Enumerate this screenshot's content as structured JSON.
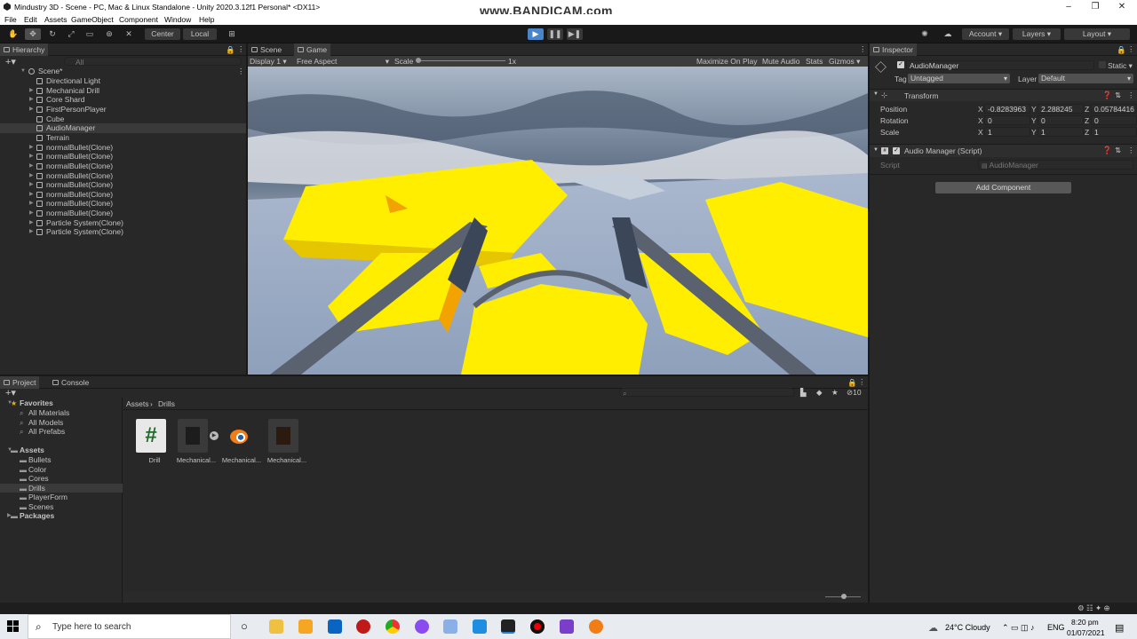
{
  "window": {
    "title": "Mindustry 3D - Scene - PC, Mac & Linux Standalone - Unity 2020.3.12f1 Personal* <DX11>",
    "watermark": "www.BANDICAM.com"
  },
  "menu": [
    "File",
    "Edit",
    "Assets",
    "GameObject",
    "Component",
    "Window",
    "Help"
  ],
  "toolbar": {
    "pivot": "Center",
    "space": "Local",
    "account": "Account",
    "layers": "Layers",
    "layout": "Layout"
  },
  "hierarchy": {
    "tab": "Hierarchy",
    "search_placeholder": "All",
    "root": "Scene*",
    "items": [
      "Directional Light",
      "Mechanical Drill",
      "Core Shard",
      "FirstPersonPlayer",
      "Cube",
      "AudioManager",
      "Terrain",
      "normalBullet(Clone)",
      "normalBullet(Clone)",
      "normalBullet(Clone)",
      "normalBullet(Clone)",
      "normalBullet(Clone)",
      "normalBullet(Clone)",
      "normalBullet(Clone)",
      "normalBullet(Clone)",
      "Particle System(Clone)",
      "Particle System(Clone)"
    ]
  },
  "game": {
    "tabs": [
      "Scene",
      "Game"
    ],
    "display": "Display 1",
    "aspect": "Free Aspect",
    "scale_label": "Scale",
    "scale_value": "1x",
    "options": [
      "Maximize On Play",
      "Mute Audio",
      "Stats",
      "Gizmos"
    ]
  },
  "inspector": {
    "tab": "Inspector",
    "object_name": "AudioManager",
    "static_label": "Static",
    "tag_label": "Tag",
    "tag_value": "Untagged",
    "layer_label": "Layer",
    "layer_value": "Default",
    "transform": {
      "title": "Transform",
      "position_label": "Position",
      "position": {
        "x": "-0.8283963",
        "y": "2.288245",
        "z": "0.05784416"
      },
      "rotation_label": "Rotation",
      "rotation": {
        "x": "0",
        "y": "0",
        "z": "0"
      },
      "scale_label": "Scale",
      "scale": {
        "x": "1",
        "y": "1",
        "z": "1"
      }
    },
    "component": {
      "title": "Audio Manager (Script)",
      "script_label": "Script",
      "script_value": "AudioManager"
    },
    "add_component": "Add Component"
  },
  "project": {
    "tabs": [
      "Project",
      "Console"
    ],
    "favorites": {
      "label": "Favorites",
      "items": [
        "All Materials",
        "All Models",
        "All Prefabs"
      ]
    },
    "assets": {
      "label": "Assets",
      "items": [
        "Bullets",
        "Color",
        "Cores",
        "Drills",
        "PlayerForm",
        "Scenes"
      ]
    },
    "packages": "Packages",
    "breadcrumb": [
      "Assets",
      "Drills"
    ],
    "hidden_count": "10",
    "files": [
      "Drill",
      "Mechanical...",
      "Mechanical...",
      "Mechanical..."
    ]
  },
  "taskbar": {
    "search_placeholder": "Type here to search",
    "weather": "24°C  Cloudy",
    "lang": "ENG",
    "time": "8:20 pm",
    "date": "01/07/2021"
  },
  "colors": {
    "accent": "#2c5d87",
    "yellow": "#ffee00",
    "play": "#4a85c9"
  }
}
